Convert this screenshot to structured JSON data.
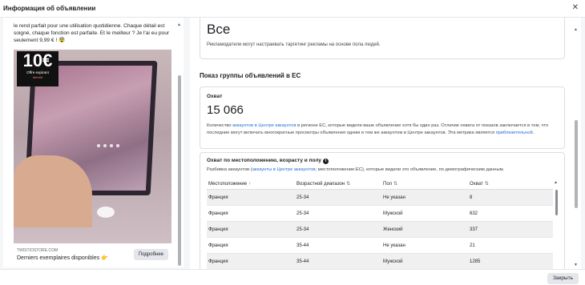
{
  "dialog": {
    "title": "Информация об объявлении",
    "close_icon": "close-icon",
    "close_button_label": "Закрыть"
  },
  "preview": {
    "body_text": "le rend parfait pour une utilisation quotidienne. Chaque détail est soigné, chaque fonction est parfaite. Et le meilleur ? Je l'ai eu pour seulement 9,99 € ! 😨",
    "badge_price": "10€",
    "badge_line1": "Offre expirant",
    "badge_line2": "bientôt",
    "site": "TWISTIOSTORE.COM",
    "headline": "Derniers exemplaires disponibles 👉",
    "cta_label": "Подробнее"
  },
  "top_card": {
    "label_partial": "Пол",
    "value": "Все",
    "description": "Рекламодатели могут настраивать таргетинг рекламы на основе пола людей."
  },
  "eu_section": {
    "title": "Показ группы объявлений в ЕС"
  },
  "reach_card": {
    "label": "Охват",
    "value": "15 066",
    "desc_before": "Количество ",
    "desc_link1": "аккаунтов в Центре аккаунтов",
    "desc_mid": " в регионе ЕС, которые видели ваше объявление хотя бы один раз. Отличие охвата от показов заключается в том, что последние могут включать многократные просмотры объявления одним и тем же аккаунтом в Центре аккаунтов. Эта метрика является ",
    "desc_link2": "приблизительной",
    "desc_end": "."
  },
  "breakdown_card": {
    "title": "Охват по местоположению, возрасту и полу",
    "desc_before": "Разбивка аккаунтов (",
    "desc_link": "аккаунты в Центре аккаунтов",
    "desc_after": "; местоположение:ЕС), которые видели это объявление, по демографическим данным.",
    "columns": [
      "Местоположение",
      "Возрастной диапазон",
      "Пол",
      "Охват"
    ],
    "rows": [
      [
        "Франция",
        "25-34",
        "Не указан",
        "8"
      ],
      [
        "Франция",
        "25-34",
        "Мужской",
        "632"
      ],
      [
        "Франция",
        "25-34",
        "Женский",
        "337"
      ],
      [
        "Франция",
        "35-44",
        "Не указан",
        "21"
      ],
      [
        "Франция",
        "35-44",
        "Мужской",
        "1285"
      ]
    ]
  }
}
